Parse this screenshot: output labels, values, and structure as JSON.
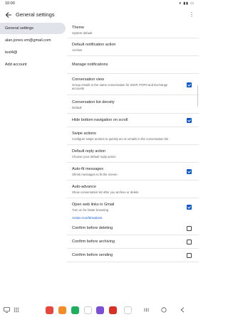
{
  "status": {
    "time": "10:00",
    "system_icons": "wifi-icon signal-icon battery-icon"
  },
  "appbar": {
    "title": "General settings"
  },
  "sidebar": {
    "items": [
      {
        "label": "General settings"
      },
      {
        "label": "alan.jones.vm@gmail.com"
      },
      {
        "label": "test4@"
      },
      {
        "label": "Add account"
      }
    ]
  },
  "settings": {
    "theme": {
      "title": "Theme",
      "subtitle": "System default"
    },
    "default_notification": {
      "title": "Default notification action",
      "subtitle": "Archive"
    },
    "manage_notifications": {
      "title": "Manage notifications"
    },
    "conversation_view": {
      "title": "Conversation view",
      "subtitle": "Group emails in the same conversation for IMAP, POP3 and Exchange accounts",
      "checked": true
    },
    "conversation_density": {
      "title": "Conversation list density",
      "subtitle": "Default"
    },
    "hide_bottom_nav": {
      "title": "Hide bottom navigation on scroll",
      "checked": true
    },
    "swipe_actions": {
      "title": "Swipe actions",
      "subtitle": "Configure swipe actions to quickly act on emails in the conversation list"
    },
    "default_reply": {
      "title": "Default reply action",
      "subtitle": "Choose your default reply action"
    },
    "auto_fit": {
      "title": "Auto-fit messages",
      "subtitle": "Shrink messages to fit the screen",
      "checked": true
    },
    "auto_advance": {
      "title": "Auto-advance",
      "subtitle": "Show conversation list after you archive or delete"
    },
    "open_web_links": {
      "title": "Open web links in Gmail",
      "subtitle": "Turn on for faster browsing",
      "checked": true
    },
    "section_action_confirmations": "Action Confirmations",
    "confirm_deleting": {
      "title": "Confirm before deleting",
      "checked": false
    },
    "confirm_archiving": {
      "title": "Confirm before archiving",
      "checked": false
    },
    "confirm_sending": {
      "title": "Confirm before sending",
      "checked": false
    }
  },
  "navbar": {
    "apps": [
      "app-icon-red",
      "app-icon-orange",
      "app-icon-green",
      "app-icon-blue",
      "app-icon-purple",
      "app-icon-red-2",
      "app-icon-grid"
    ]
  },
  "colors": {
    "accent": "#0b57d0",
    "sidebar_active": "#e1e3ea"
  }
}
